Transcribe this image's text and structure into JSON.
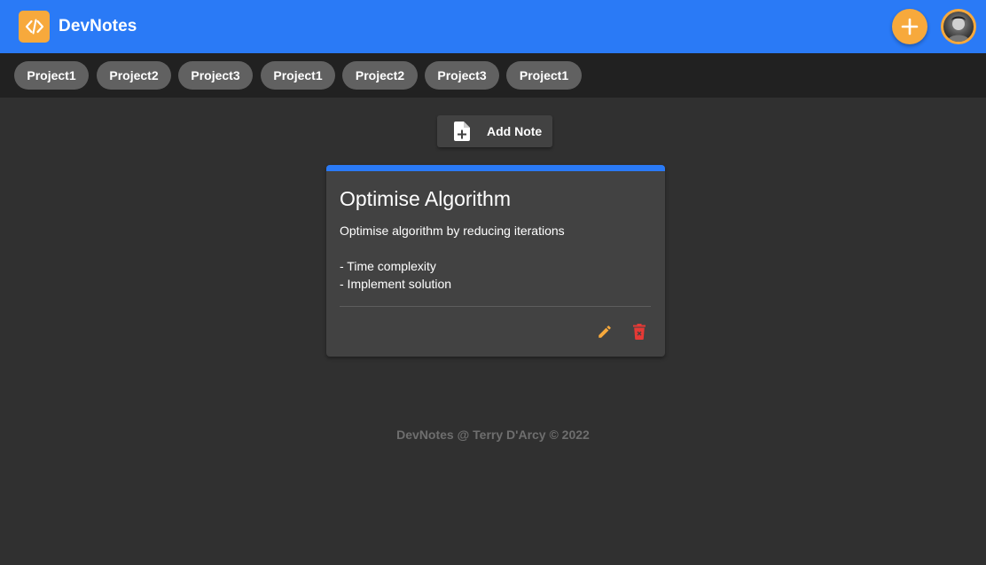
{
  "app": {
    "title": "DevNotes",
    "accent_color": "#2a7af6",
    "secondary_color": "#f7a93c",
    "background_color": "#303030",
    "logo_icon": "code-icon"
  },
  "header": {
    "add_icon": "plus-icon",
    "avatar": "user-avatar"
  },
  "projects": [
    {
      "label": "Project1"
    },
    {
      "label": "Project2"
    },
    {
      "label": "Project3"
    },
    {
      "label": "Project1"
    },
    {
      "label": "Project2"
    },
    {
      "label": "Project3"
    },
    {
      "label": "Project1"
    }
  ],
  "toolbar": {
    "add_note_label": "Add Note",
    "add_note_icon": "note-add-icon"
  },
  "notes": [
    {
      "title": "Optimise Algorithm",
      "body": "Optimise algorithm by reducing iterations\n\n- Time complexity\n- Implement solution",
      "edit_icon": "pencil-icon",
      "delete_icon": "trash-icon",
      "edit_color": "#f7a93c",
      "delete_color": "#e53935"
    }
  ],
  "footer": {
    "text": "DevNotes @ Terry D'Arcy © 2022"
  }
}
